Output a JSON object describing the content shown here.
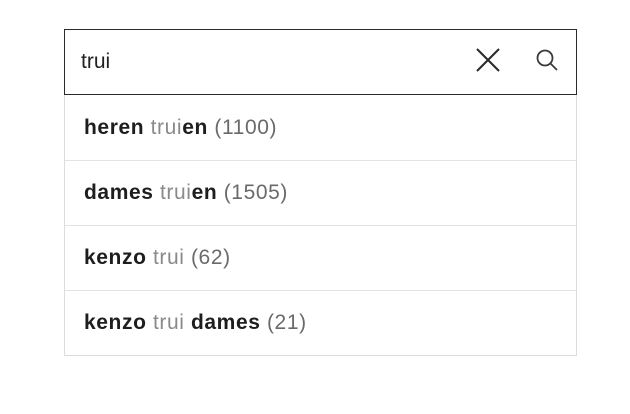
{
  "search": {
    "value": "trui",
    "clear_icon": "close-icon",
    "search_icon": "search-icon"
  },
  "suggestions": [
    {
      "parts": [
        {
          "text": "heren",
          "style": "bold"
        },
        {
          "text": "trui",
          "style": "light"
        },
        {
          "text": "en",
          "style": "bold"
        }
      ],
      "count": "(1100)"
    },
    {
      "parts": [
        {
          "text": "dames",
          "style": "bold"
        },
        {
          "text": "trui",
          "style": "light"
        },
        {
          "text": "en",
          "style": "bold"
        }
      ],
      "count": "(1505)"
    },
    {
      "parts": [
        {
          "text": "kenzo",
          "style": "bold"
        },
        {
          "text": "trui",
          "style": "light"
        }
      ],
      "count": "(62)"
    },
    {
      "parts": [
        {
          "text": "kenzo",
          "style": "bold"
        },
        {
          "text": "trui",
          "style": "light"
        },
        {
          "text": "dames",
          "style": "bold"
        }
      ],
      "count": "(21)"
    }
  ],
  "colors": {
    "border": "#2a2a2a",
    "bold_text": "#1e1e1e",
    "light_text": "#8a8a8a"
  }
}
